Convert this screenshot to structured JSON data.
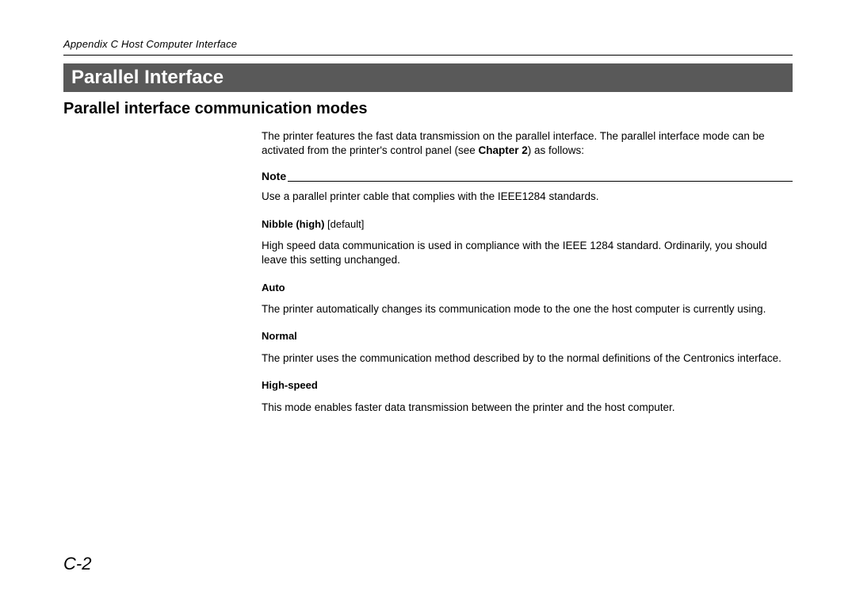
{
  "header": {
    "running": "Appendix C  Host Computer Interface"
  },
  "banner": "Parallel Interface",
  "subsection": "Parallel interface communication modes",
  "intro": {
    "pre": "The printer features the fast data transmission on the parallel interface. The parallel interface mode can be activated from the printer's control panel (see ",
    "chapter": "Chapter 2",
    "post": ") as follows:"
  },
  "note": {
    "label": "Note",
    "text": "Use a parallel printer cable that complies with the IEEE1284 standards."
  },
  "modes": [
    {
      "name": "Nibble (high)",
      "default": " [default]",
      "desc": "High speed data communication is used in compliance with the IEEE 1284 standard. Ordinarily, you should leave this setting unchanged."
    },
    {
      "name": "Auto",
      "default": "",
      "desc": "The printer automatically changes its communication mode to the one the host computer is currently using."
    },
    {
      "name": "Normal",
      "default": "",
      "desc": "The printer uses the communication method described by to the normal definitions of the Centronics interface."
    },
    {
      "name": "High-speed",
      "default": "",
      "desc": "This mode enables faster data transmission between the printer and the host computer."
    }
  ],
  "pageNumber": "C-2"
}
